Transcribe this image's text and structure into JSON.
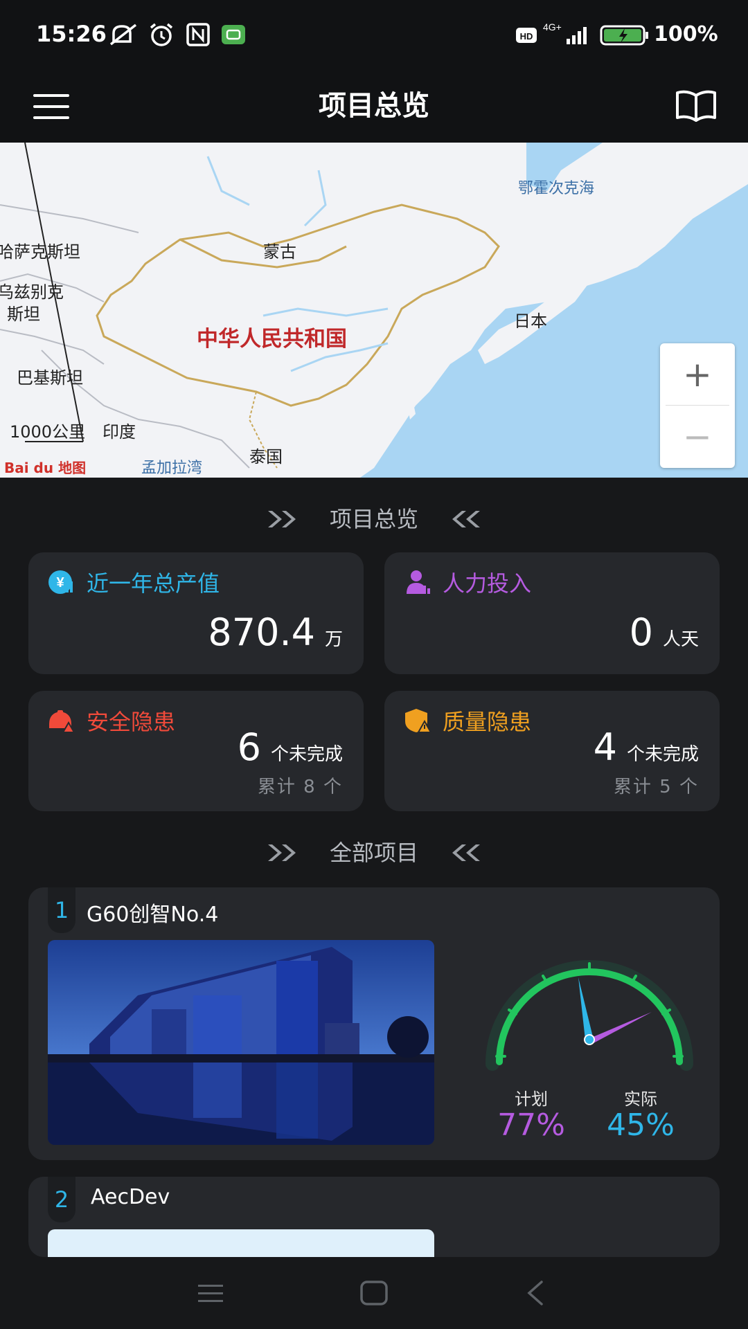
{
  "status_bar": {
    "time": "15:26",
    "network": "4G+",
    "hd_badge": "HD",
    "battery": "100%"
  },
  "header": {
    "title": "项目总览",
    "menu_icon": "menu-icon",
    "book_icon": "book-icon"
  },
  "map": {
    "labels": {
      "kazakhstan": "哈萨克斯坦",
      "uzbekistan_1": "乌兹别克",
      "uzbekistan_2": "斯坦",
      "pakistan": "巴基斯坦",
      "mongolia": "蒙古",
      "okhotsk": "鄂霍次克海",
      "japan": "日本",
      "china": "中华人民共和国",
      "india": "印度",
      "thailand": "泰国",
      "bengal": "孟加拉湾"
    },
    "scale": "1000公里",
    "logo": "Bai du 地图",
    "zoom_in": "+",
    "zoom_out": "−"
  },
  "overview": {
    "section_title": "项目总览",
    "output": {
      "title": "近一年总产值",
      "value": "870.4",
      "unit": "万",
      "color": "#2fb6e8"
    },
    "labor": {
      "title": "人力投入",
      "value": "0",
      "unit": "人天",
      "color": "#b55be0"
    },
    "safety": {
      "title": "安全隐患",
      "value": "6",
      "unit": "个未完成",
      "sub": "累计 8 个",
      "color": "#f04a3a"
    },
    "quality": {
      "title": "质量隐患",
      "value": "4",
      "unit": "个未完成",
      "sub": "累计 5 个",
      "color": "#f0a020"
    }
  },
  "projects": {
    "section_title": "全部项目",
    "items": [
      {
        "index": "1",
        "name": "G60创智No.4",
        "plan_label": "计划",
        "plan_value": "77%",
        "actual_label": "实际",
        "actual_value": "45%"
      },
      {
        "index": "2",
        "name": "AecDev"
      }
    ]
  },
  "colors": {
    "plan": "#b55be0",
    "actual": "#2fb6e8",
    "gauge": "#22c55e"
  }
}
